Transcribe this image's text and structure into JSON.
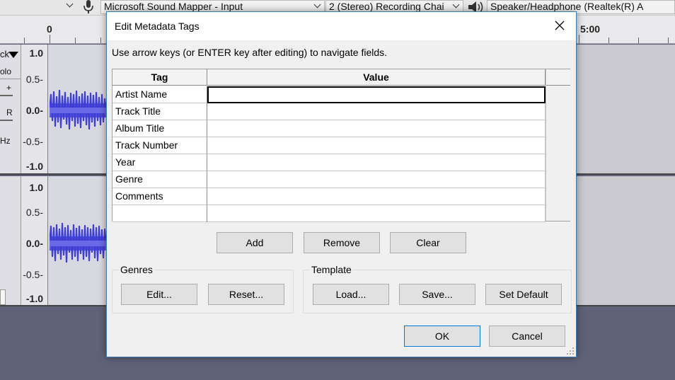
{
  "app": {
    "toolbar": {
      "input_device": "Microsoft Sound Mapper - Input",
      "channels": "2 (Stereo) Recording Chai",
      "output_device": "Speaker/Headphone (Realtek(R) A"
    },
    "ruler": {
      "labels": [
        "0",
        "5:00"
      ]
    },
    "tracks": [
      {
        "scale": [
          "1.0",
          "0.5-",
          "0.0-",
          "-0.5-",
          "-1.0"
        ],
        "controls": {
          "menu": "ck",
          "solo": "olo",
          "gain": "+",
          "pan": "R",
          "rate": "Hz"
        }
      },
      {
        "scale": [
          "1.0",
          "0.5-",
          "0.0-",
          "-0.5-",
          "-1.0"
        ]
      }
    ],
    "colors": {
      "wave": "#3f3fd6",
      "wave_center": "#6a6ae8",
      "background": "#5f6378"
    }
  },
  "dialog": {
    "title": "Edit Metadata Tags",
    "hint": "Use arrow keys (or ENTER key after editing) to navigate fields.",
    "columns": {
      "tag": "Tag",
      "value": "Value"
    },
    "rows": [
      {
        "tag": "Artist Name",
        "value": ""
      },
      {
        "tag": "Track Title",
        "value": ""
      },
      {
        "tag": "Album Title",
        "value": ""
      },
      {
        "tag": "Track Number",
        "value": ""
      },
      {
        "tag": "Year",
        "value": ""
      },
      {
        "tag": "Genre",
        "value": ""
      },
      {
        "tag": "Comments",
        "value": ""
      },
      {
        "tag": "",
        "value": ""
      }
    ],
    "buttons": {
      "add": "Add",
      "remove": "Remove",
      "clear": "Clear",
      "ok": "OK",
      "cancel": "Cancel"
    },
    "genres": {
      "label": "Genres",
      "edit": "Edit...",
      "reset": "Reset..."
    },
    "template": {
      "label": "Template",
      "load": "Load...",
      "save": "Save...",
      "set_default": "Set Default"
    }
  }
}
